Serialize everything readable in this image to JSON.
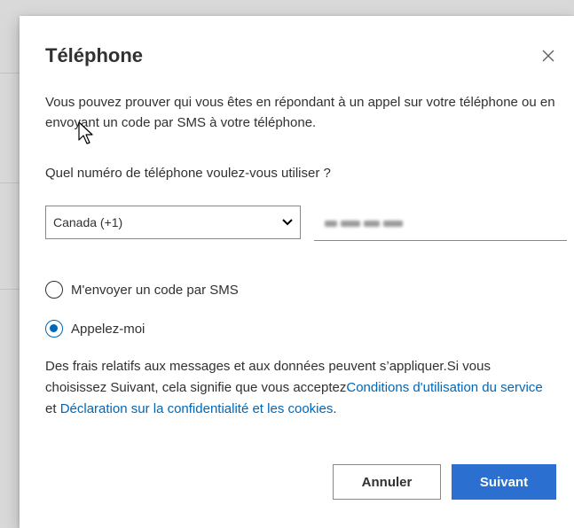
{
  "dialog": {
    "title": "Téléphone",
    "close_icon": "close-icon",
    "description": "Vous pouvez prouver qui vous êtes en répondant à un appel sur votre téléphone ou en envoyant un code par SMS à votre téléphone.",
    "question": "Quel numéro de téléphone voulez-vous utiliser ?",
    "country_select": {
      "selected": "Canada (+1)",
      "icon": "chevron-down-icon"
    },
    "phone_input": {
      "value": ""
    },
    "options": [
      {
        "label": "M'envoyer un code par SMS",
        "checked": false
      },
      {
        "label": "Appelez-moi",
        "checked": true
      }
    ],
    "notice": {
      "text": "Des frais relatifs aux messages et aux données peuvent s’appliquer.Si vous choisissez Suivant, cela signifie que vous acceptez",
      "terms_link": "Conditions d'utilisation du service",
      "and": " et ",
      "privacy_link": "Déclaration sur la confidentialité et les cookies",
      "end": "."
    },
    "buttons": {
      "cancel": "Annuler",
      "next": "Suivant"
    },
    "colors": {
      "accent": "#0067b8",
      "primary_button": "#2b6fd0"
    }
  }
}
